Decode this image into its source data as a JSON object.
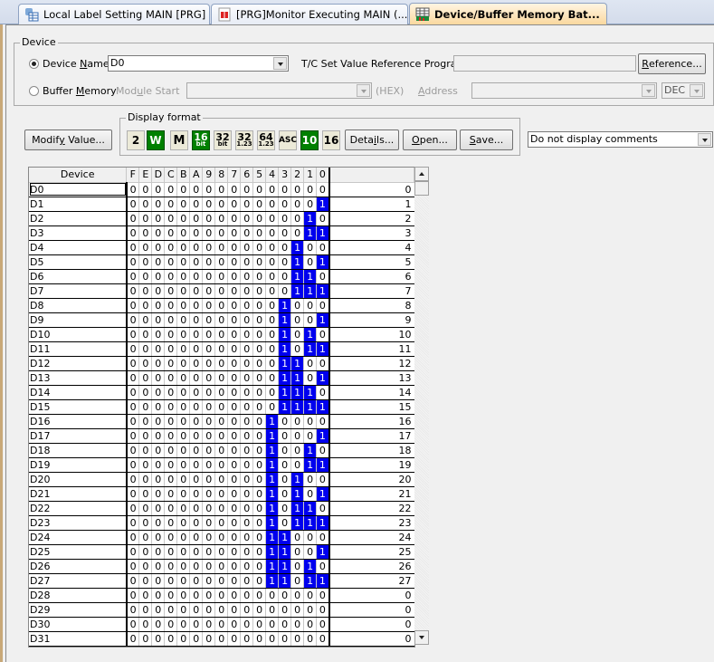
{
  "tabs": [
    {
      "label": "Local Label Setting MAIN [PRG]",
      "icon": "local-label-icon",
      "active": false
    },
    {
      "label": "[PRG]Monitor Executing MAIN (...",
      "icon": "program-icon",
      "active": false
    },
    {
      "label": "Device/Buffer Memory Bat...",
      "icon": "batch-monitor-icon",
      "active": true,
      "close": "✕"
    }
  ],
  "device_group": {
    "legend": "Device",
    "device_name_label": "Device Name",
    "device_name_value": "D0",
    "device_name_selected": true,
    "tc_label": "T/C Set Value Reference Program",
    "tc_value": "",
    "reference_button": "Reference...",
    "buffer_memory_label": "Buffer Memory",
    "module_start_label": "Module Start",
    "hex_label": "(HEX)",
    "address_label": "Address",
    "address_format": "DEC"
  },
  "toolbar": {
    "modify_value": "Modify Value...",
    "display_format_legend": "Display format",
    "formats": [
      {
        "name": "binary",
        "text": "2",
        "on": false
      },
      {
        "name": "word",
        "text": "W",
        "on": true
      },
      {
        "name": "multi",
        "text": "M",
        "on": false
      },
      {
        "name": "16bit",
        "top": "16",
        "bottom": "bit",
        "on": true
      },
      {
        "name": "32bit",
        "top": "32",
        "bottom": "bit",
        "on": false
      },
      {
        "name": "32real",
        "top": "32",
        "bottom": "1.23",
        "on": false
      },
      {
        "name": "64real",
        "top": "64",
        "bottom": "1.23",
        "on": false
      },
      {
        "name": "ascii",
        "text": "ASC",
        "on": false
      },
      {
        "name": "decimal",
        "text": "10",
        "on": true
      },
      {
        "name": "hex",
        "text": "16",
        "on": false
      }
    ],
    "details": "Details...",
    "open": "Open...",
    "save": "Save...",
    "comments_option": "Do not display comments"
  },
  "grid": {
    "header_device": "Device",
    "bit_headers": [
      "F",
      "E",
      "D",
      "C",
      "B",
      "A",
      "9",
      "8",
      "7",
      "6",
      "5",
      "4",
      "3",
      "2",
      "1",
      "0"
    ],
    "rows": [
      {
        "device": "D0",
        "value": 0
      },
      {
        "device": "D1",
        "value": 1
      },
      {
        "device": "D2",
        "value": 2
      },
      {
        "device": "D3",
        "value": 3
      },
      {
        "device": "D4",
        "value": 4
      },
      {
        "device": "D5",
        "value": 5
      },
      {
        "device": "D6",
        "value": 6
      },
      {
        "device": "D7",
        "value": 7
      },
      {
        "device": "D8",
        "value": 8
      },
      {
        "device": "D9",
        "value": 9
      },
      {
        "device": "D10",
        "value": 10
      },
      {
        "device": "D11",
        "value": 11
      },
      {
        "device": "D12",
        "value": 12
      },
      {
        "device": "D13",
        "value": 13
      },
      {
        "device": "D14",
        "value": 14
      },
      {
        "device": "D15",
        "value": 15
      },
      {
        "device": "D16",
        "value": 16
      },
      {
        "device": "D17",
        "value": 17
      },
      {
        "device": "D18",
        "value": 18
      },
      {
        "device": "D19",
        "value": 19
      },
      {
        "device": "D20",
        "value": 20
      },
      {
        "device": "D21",
        "value": 21
      },
      {
        "device": "D22",
        "value": 22
      },
      {
        "device": "D23",
        "value": 23
      },
      {
        "device": "D24",
        "value": 24
      },
      {
        "device": "D25",
        "value": 25
      },
      {
        "device": "D26",
        "value": 26
      },
      {
        "device": "D27",
        "value": 27
      },
      {
        "device": "D28",
        "value": 0
      },
      {
        "device": "D29",
        "value": 0
      },
      {
        "device": "D30",
        "value": 0
      },
      {
        "device": "D31",
        "value": 0
      }
    ],
    "selected_row": 0
  },
  "colors": {
    "bit_on": "#0000ee",
    "format_on": "#008000",
    "active_tab": "#fad79c"
  }
}
